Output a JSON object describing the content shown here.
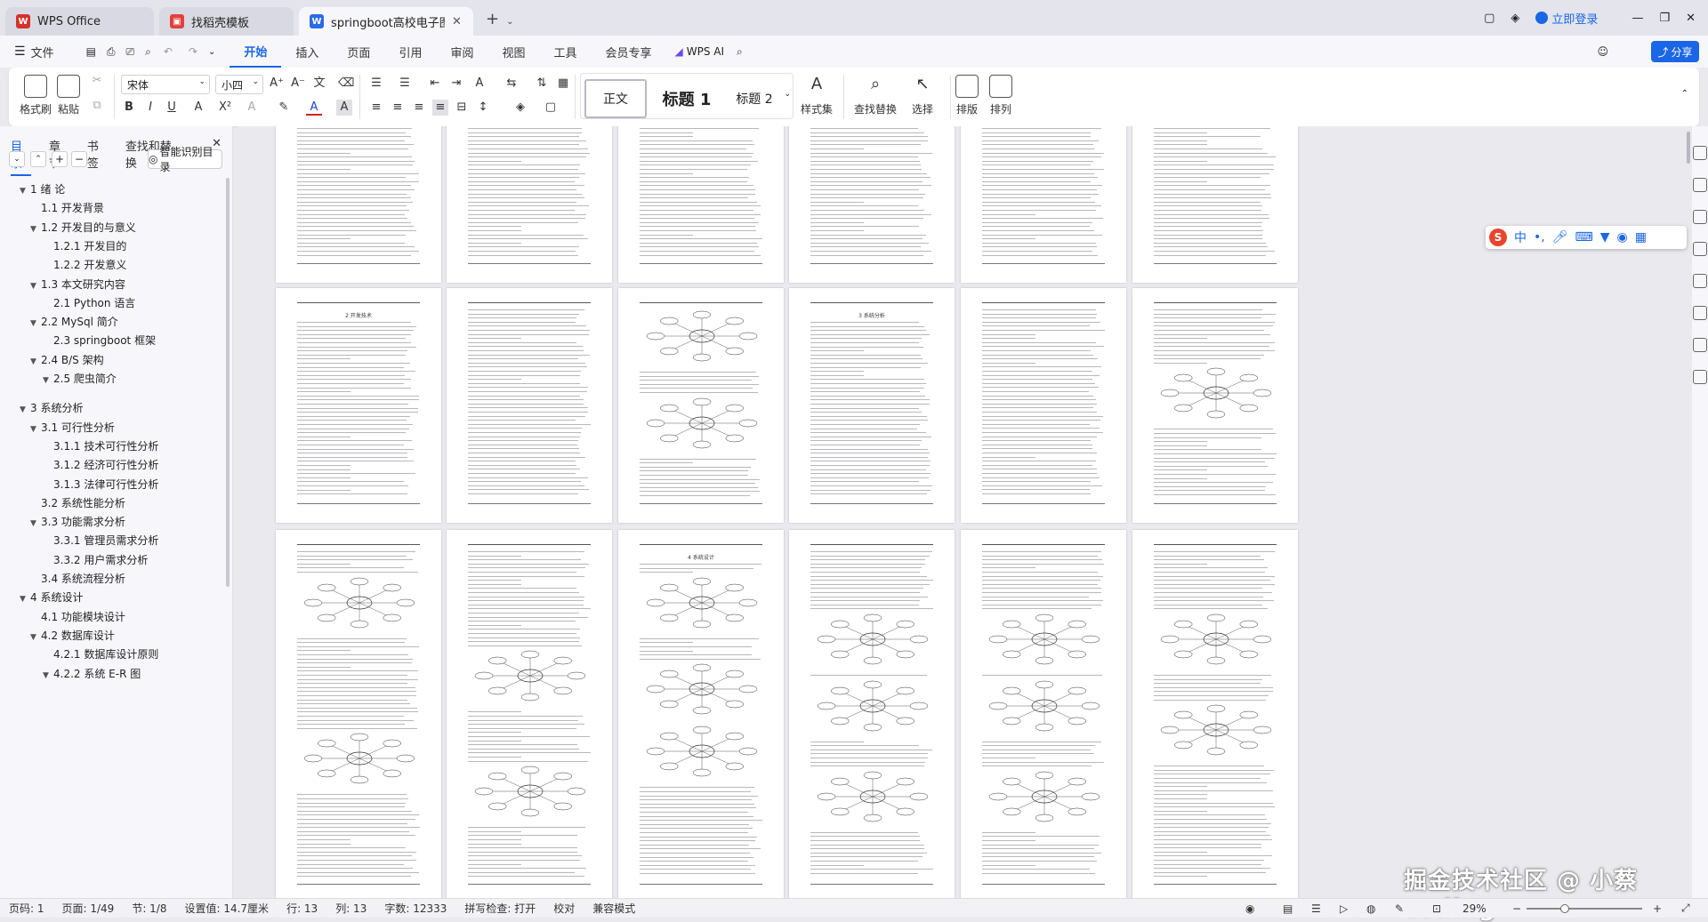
{
  "titlebar": {
    "tabs": [
      {
        "label": "WPS Office",
        "icon": "wps-logo"
      },
      {
        "label": "找稻壳模板",
        "icon": "docer-logo"
      },
      {
        "label": "springboot高校电子图书馆的",
        "icon": "word-doc-icon"
      }
    ],
    "login_label": "立即登录"
  },
  "menubar": {
    "file_label": "文件",
    "items": [
      "开始",
      "插入",
      "页面",
      "引用",
      "审阅",
      "视图",
      "工具",
      "会员专享"
    ],
    "wps_ai_label": "WPS AI",
    "share_label": "分享"
  },
  "ribbon": {
    "format_painter": "格式刷",
    "paste": "粘贴",
    "font_name": "宋体",
    "font_size": "小四",
    "styles": [
      "正文",
      "标题 1",
      "标题 2"
    ],
    "style_set": "样式集",
    "find_replace": "查找替换",
    "select": "选择",
    "layout": "排版",
    "arrange": "排列"
  },
  "leftpane": {
    "tabs": [
      "目录",
      "章节",
      "书签",
      "查找和替换"
    ],
    "smart_toc_label": "智能识别目录",
    "toc": [
      {
        "label": "1 绪  论",
        "level": 1,
        "caret": "▼"
      },
      {
        "label": "1.1 开发背景",
        "level": 2,
        "caret": ""
      },
      {
        "label": "1.2 开发目的与意义",
        "level": 2,
        "caret": "▼"
      },
      {
        "label": "1.2.1 开发目的",
        "level": 3,
        "caret": ""
      },
      {
        "label": "1.2.2 开发意义",
        "level": 3,
        "caret": ""
      },
      {
        "label": "1.3 本文研究内容",
        "level": 2,
        "caret": "▼"
      },
      {
        "label": "2.1 Python 语言",
        "level": 3,
        "caret": ""
      },
      {
        "label": "2.2 MySql 简介",
        "level": 2,
        "caret": "▼"
      },
      {
        "label": "2.3 springboot 框架",
        "level": 3,
        "caret": ""
      },
      {
        "label": "2.4 B/S 架构",
        "level": 2,
        "caret": "▼"
      },
      {
        "label": "2.5  爬虫简介",
        "level": 3,
        "caret": "▼"
      },
      {
        "label": "3 系统分析",
        "level": 1,
        "caret": "▼",
        "gap": true
      },
      {
        "label": "3.1 可行性分析",
        "level": 2,
        "caret": "▼"
      },
      {
        "label": "3.1.1 技术可行性分析",
        "level": 3,
        "caret": ""
      },
      {
        "label": "3.1.2 经济可行性分析",
        "level": 3,
        "caret": ""
      },
      {
        "label": "3.1.3 法律可行性分析",
        "level": 3,
        "caret": ""
      },
      {
        "label": "3.2 系统性能分析",
        "level": 2,
        "caret": ""
      },
      {
        "label": "3.3 功能需求分析",
        "level": 2,
        "caret": "▼"
      },
      {
        "label": "3.3.1 管理员需求分析",
        "level": 3,
        "caret": ""
      },
      {
        "label": "3.3.2 用户需求分析",
        "level": 3,
        "caret": ""
      },
      {
        "label": "3.4 系统流程分析",
        "level": 2,
        "caret": ""
      },
      {
        "label": "4 系统设计",
        "level": 1,
        "caret": "▼"
      },
      {
        "label": "4.1 功能模块设计",
        "level": 2,
        "caret": ""
      },
      {
        "label": "4.2 数据库设计",
        "level": 2,
        "caret": "▼"
      },
      {
        "label": "4.2.1 数据库设计原则",
        "level": 3,
        "caret": ""
      },
      {
        "label": "4.2.2 系统 E-R 图",
        "level": 3,
        "caret": "▼"
      }
    ]
  },
  "document": {
    "page_headings": {
      "p2_1": "2 开发技术",
      "p2_4": "3 系统分析",
      "p3_3": "4 系统设计"
    }
  },
  "ime": {
    "label": "中"
  },
  "watermark": "掘金技术社区 @ 小蔡coding",
  "statusbar": {
    "page": "页码: 1",
    "page_of": "页面: 1/49",
    "section": "节: 1/8",
    "setting": "设置值: 14.7厘米",
    "row": "行: 13",
    "col": "列: 13",
    "words": "字数: 12333",
    "spell": "拼写检查: 打开",
    "proof": "校对",
    "compat": "兼容模式",
    "zoom": "29%"
  }
}
